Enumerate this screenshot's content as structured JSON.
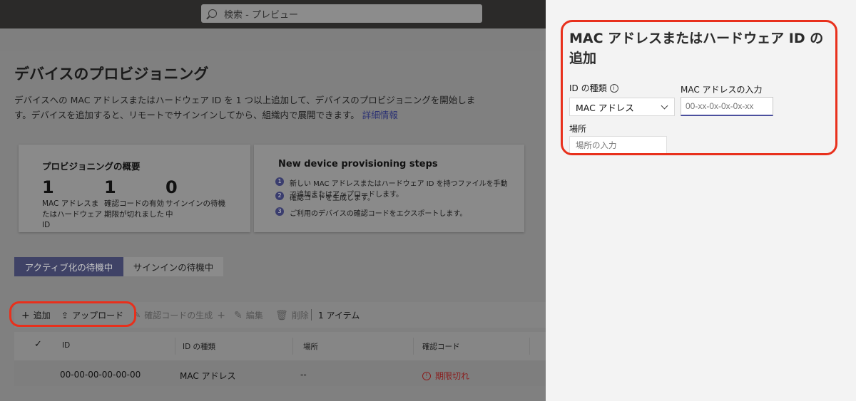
{
  "search": {
    "placeholder": "検索 - プレビュー"
  },
  "page": {
    "title": "デバイスのプロビジョニング",
    "description": "デバイスへの MAC アドレスまたはハードウェア ID を 1 つ以上追加して、デバイスのプロビジョニングを開始します。デバイスを追加すると、リモートでサインインしてから、組織内で展開できます。",
    "learn_more": "詳細情報"
  },
  "overview": {
    "title": "プロビジョニングの概要",
    "stats": [
      {
        "value": "1",
        "label": "MAC アドレスまたはハードウェア ID"
      },
      {
        "value": "1",
        "label": "確認コードの有効期限が切れました"
      },
      {
        "value": "0",
        "label": "サインインの待機中"
      }
    ]
  },
  "steps_card": {
    "title": "New device provisioning steps",
    "steps": [
      {
        "n": "1",
        "text": "新しい MAC アドレスまたはハードウェア ID を持つファイルを手動で追加またはアップロードします。"
      },
      {
        "n": "2",
        "text": "確認コードを生成します。"
      },
      {
        "n": "3",
        "text": "ご利用のデバイスの確認コードをエクスポートします。"
      }
    ]
  },
  "tabs": {
    "active": "アクティブ化の待機中",
    "other": "サインインの待機中"
  },
  "toolbar": {
    "add": "追加",
    "upload": "アップロード",
    "generate": "確認コードの生成",
    "edit": "編集",
    "delete": "削除",
    "count": "1 アイテム"
  },
  "table": {
    "headers": {
      "id": "ID",
      "id_type": "ID の種類",
      "location": "場所",
      "code": "確認コード"
    },
    "rows": [
      {
        "id": "00-00-00-00-00-00",
        "id_type": "MAC アドレス",
        "location": "--",
        "code": "期限切れ"
      }
    ]
  },
  "panel": {
    "title": "MAC アドレスまたはハードウェア ID の追加",
    "id_type_label": "ID の種類",
    "id_type_value": "MAC アドレス",
    "mac_label": "MAC アドレスの入力",
    "mac_placeholder": "00-xx-0x-0x-0x-xx",
    "location_label": "場所",
    "location_placeholder": "場所の入力"
  },
  "colors": {
    "accent": "#4b4f9e",
    "callout": "#e8301c",
    "expired": "#c0392b"
  }
}
